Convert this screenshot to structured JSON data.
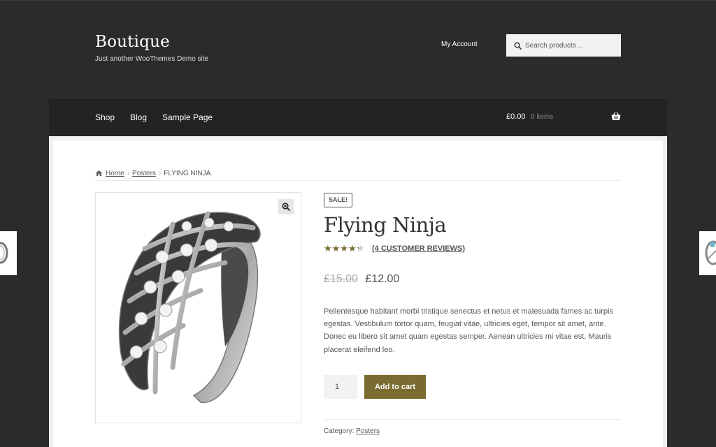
{
  "site": {
    "title": "Boutique",
    "description": "Just another WooThemes Demo site"
  },
  "header": {
    "my_account": "My Account",
    "search_placeholder": "Search products…"
  },
  "nav": {
    "items": [
      {
        "label": "Shop"
      },
      {
        "label": "Blog"
      },
      {
        "label": "Sample Page"
      }
    ],
    "cart_total": "£0.00",
    "cart_count": "0 items"
  },
  "breadcrumb": {
    "home": "Home",
    "category": "Posters",
    "current": "FLYING NINJA",
    "separator": "›"
  },
  "product": {
    "badge": "SALE!",
    "title": "Flying Ninja",
    "rating": 4,
    "rating_max": 5,
    "reviews_label": "(4 CUSTOMER REVIEWS)",
    "old_price": "£15.00",
    "new_price": "£12.00",
    "description": "Pellentesque habitant morbi tristique senectus et netus et malesuada fames ac turpis egestas. Vestibulum tortor quam, feugiat vitae, ultricies eget, tempor sit amet, ante. Donec eu libero sit amet quam egestas semper. Aenean ultricies mi vitae est. Mauris placerat eleifend leo.",
    "quantity": "1",
    "add_to_cart": "Add to cart",
    "category_label": "Category:",
    "category": "Posters",
    "image_alt": "silver-ring-image"
  },
  "colors": {
    "background": "#2b2b2b",
    "navbar": "#232323",
    "accent": "#7a6c30",
    "star": "#7d7035"
  },
  "icons": {
    "search": "search-icon",
    "cart": "basket-icon",
    "home": "home-icon",
    "zoom": "zoom-in-icon"
  }
}
